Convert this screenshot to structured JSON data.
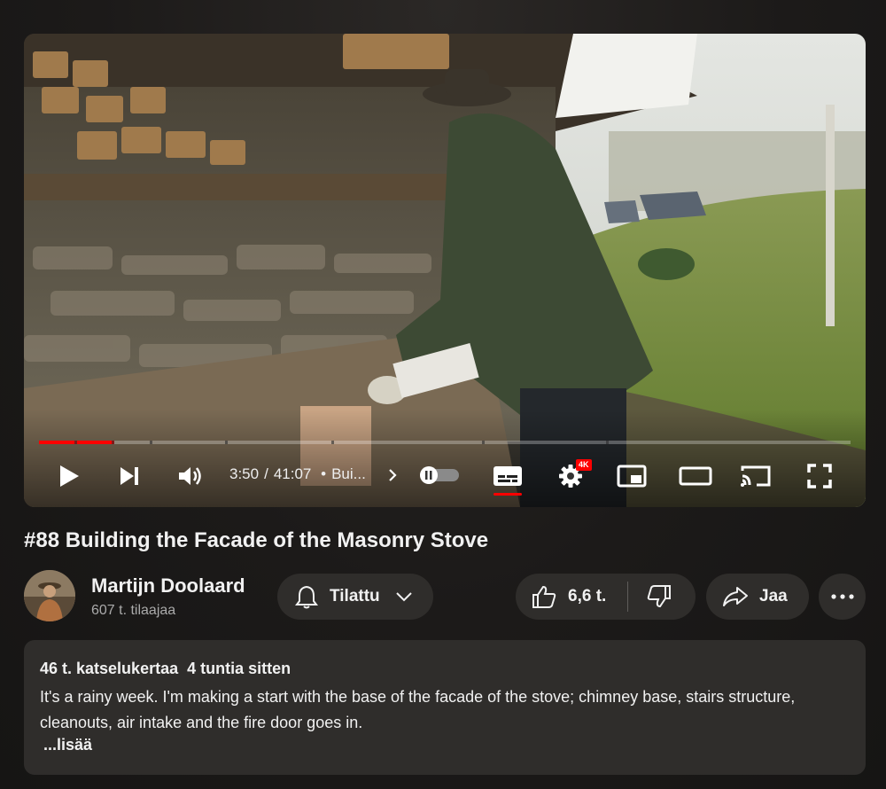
{
  "video": {
    "progress_fraction": 0.093,
    "time_current": "3:50",
    "time_total": "41:07",
    "time_separator": "/",
    "chapter_bullet": "•",
    "chapter_title": "Bui...",
    "quality_badge": "4K"
  },
  "title": "#88 Building the Facade of the Masonry Stove",
  "channel": {
    "name": "Martijn Doolaard",
    "subscribers": "607 t. tilaajaa",
    "subscribe_label": "Tilattu"
  },
  "actions": {
    "like_count": "6,6 t.",
    "share_label": "Jaa"
  },
  "description": {
    "views": "46 t. katselukertaa",
    "age": "4 tuntia sitten",
    "text": "It's a rainy week. I'm making a start with the base of the facade of the stove; chimney base, stairs structure, cleanouts, air intake and the fire door goes in.",
    "more_label": "...lisää"
  },
  "colors": {
    "accent": "#ff0000",
    "pill_bg": "#2f2d2b",
    "page_bg": "#1c1a19"
  }
}
